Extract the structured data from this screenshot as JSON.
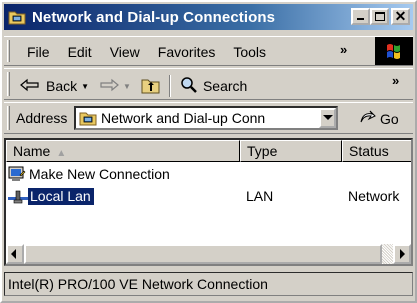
{
  "window": {
    "title": "Network and Dial-up Connections",
    "title_icon": "network-folder-icon",
    "controls": {
      "close_label": "✕"
    }
  },
  "menubar": {
    "items": [
      {
        "label": "File"
      },
      {
        "label": "Edit"
      },
      {
        "label": "View"
      },
      {
        "label": "Favorites"
      },
      {
        "label": "Tools"
      }
    ],
    "overflow": "»"
  },
  "toolbar": {
    "back_label": "Back",
    "forward_icon": "forward-arrow-icon",
    "up_icon": "up-folder-icon",
    "search_label": "Search",
    "overflow": "»"
  },
  "addressbar": {
    "label": "Address",
    "value": "Network and Dial-up Conn",
    "go_label": "Go"
  },
  "listview": {
    "columns": [
      {
        "label": "Name",
        "sort": "ascending"
      },
      {
        "label": "Type"
      },
      {
        "label": "Status"
      }
    ],
    "sort_indicator": "▲",
    "rows": [
      {
        "name": "Make New Connection",
        "type": "",
        "status": "",
        "icon": "make-new-connection-icon",
        "selected": false
      },
      {
        "name": "Local Lan",
        "type": "LAN",
        "status": "Network",
        "icon": "lan-connection-icon",
        "selected": true
      }
    ]
  },
  "statusbar": {
    "text": "Intel(R) PRO/100 VE Network Connection"
  },
  "colors": {
    "titlebar_start": "#0a246a",
    "titlebar_end": "#a6caf0",
    "selection": "#0a246a",
    "face": "#d4d0c8"
  }
}
